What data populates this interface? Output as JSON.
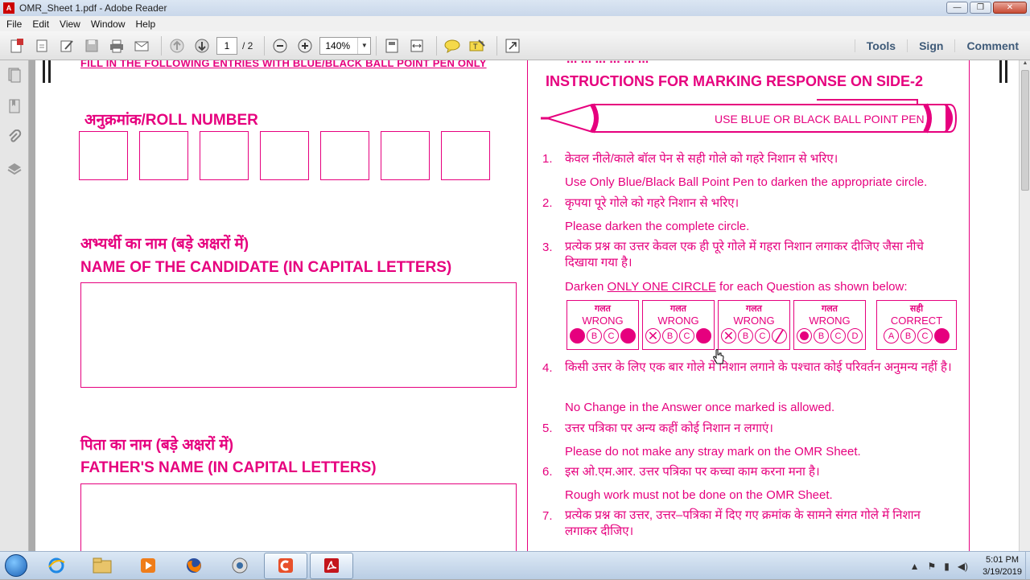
{
  "window": {
    "title": "OMR_Sheet 1.pdf - Adobe Reader",
    "controls": [
      "—",
      "❐",
      "✕"
    ]
  },
  "menu": [
    "File",
    "Edit",
    "View",
    "Window",
    "Help"
  ],
  "toolbar": {
    "current_page": "1",
    "total_pages": "/ 2",
    "zoom": "140%",
    "links": [
      "Tools",
      "Sign",
      "Comment"
    ]
  },
  "icons": {
    "create": "create-pdf-icon",
    "open": "open-icon",
    "edit": "edit-icon",
    "save": "save-icon",
    "print": "print-icon",
    "email": "email-icon",
    "prev": "prev-page-icon",
    "next": "next-page-icon",
    "zoom_out": "zoom-out-icon",
    "zoom_in": "zoom-in-icon",
    "fit_page": "fit-page-icon",
    "fit_width": "fit-width-icon",
    "comment": "sticky-note-icon",
    "highlight": "highlight-icon",
    "expand": "expand-icon"
  },
  "colors": {
    "accent": "#e6007e",
    "link": "#3e5a78"
  },
  "sheet": {
    "banner": "FILL IN THE FOLLOWING ENTRIES WITH BLUE/BLACK BALL POINT PEN ONLY",
    "roll_label": "अनुक्रमांक/ROLL NUMBER",
    "roll_boxes": 7,
    "candidate_hindi": "अभ्यर्थी का नाम (बड़े अक्षरों में)",
    "candidate_eng": "NAME OF THE CANDIDATE (IN CAPITAL LETTERS)",
    "father_hindi": "पिता का नाम (बड़े अक्षरों में)",
    "father_eng": "FATHER'S NAME (IN CAPITAL LETTERS)"
  },
  "instructions": {
    "top_cut": "... ... ... ... ... ...",
    "title": "INSTRUCTIONS FOR MARKING RESPONSE ON SIDE-2",
    "pen_label": "USE BLUE OR BLACK BALL POINT PEN",
    "items": [
      {
        "num": "1.",
        "hindi": "केवल नीले/काले बॉल पेन से सही गोले को गहरे निशान से भरिए।",
        "eng": "Use Only Blue/Black Ball Point Pen to darken the appropriate circle."
      },
      {
        "num": "2.",
        "hindi": "कृपया पूरे गोले को गहरे निशान से भरिए।",
        "eng": "Please darken the complete circle."
      },
      {
        "num": "3.",
        "hindi": "प्रत्येक प्रश्न का उत्तर केवल एक ही पूरे गोले में गहरा निशान लगाकर दीजिए जैसा नीचे दिखाया गया है।",
        "eng_prefix": "Darken ",
        "eng_underline": "ONLY ONE CIRCLE",
        "eng_suffix": " for each Question as shown below:"
      },
      {
        "num": "4.",
        "hindi": "किसी उत्तर के लिए एक बार गोले में निशान लगाने के पश्चात कोई परिवर्तन अनुमन्य नहीं है।",
        "eng": "No Change in the Answer once marked is allowed."
      },
      {
        "num": "5.",
        "hindi": "उत्तर पत्रिका पर अन्य कहीं कोई निशान न लगाएं।",
        "eng": "Please do not make any stray mark on the OMR Sheet."
      },
      {
        "num": "6.",
        "hindi": "इस ओ.एम.आर. उत्तर पत्रिका पर कच्चा काम करना मना है।",
        "eng": "Rough work must not be done on the OMR Sheet."
      },
      {
        "num": "7.",
        "hindi": "प्रत्येक प्रश्न का उत्तर, उत्तर–पत्रिका में दिए गए क्रमांक के सामने संगत गोले में निशान लगाकर दीजिए।"
      }
    ],
    "examples": [
      {
        "hindi": "गलत",
        "eng": "WRONG",
        "bubbles": [
          "fill",
          "B",
          "C",
          "fill"
        ]
      },
      {
        "hindi": "गलत",
        "eng": "WRONG",
        "bubbles": [
          "cross",
          "B",
          "C",
          "fill"
        ]
      },
      {
        "hindi": "गलत",
        "eng": "WRONG",
        "bubbles": [
          "cross",
          "B",
          "C",
          "slash"
        ]
      },
      {
        "hindi": "गलत",
        "eng": "WRONG",
        "bubbles": [
          "dot",
          "B",
          "C",
          "D"
        ]
      },
      {
        "hindi": "सही",
        "eng": "CORRECT",
        "bubbles": [
          "A",
          "B",
          "C",
          "fill"
        ]
      }
    ]
  },
  "taskbar": {
    "apps": [
      "ie-icon",
      "explorer-icon",
      "media-player-icon",
      "firefox-icon",
      "media-center-icon",
      "camtasia-icon",
      "adobe-reader-icon"
    ],
    "time": "5:01 PM",
    "date": "3/19/2019"
  }
}
